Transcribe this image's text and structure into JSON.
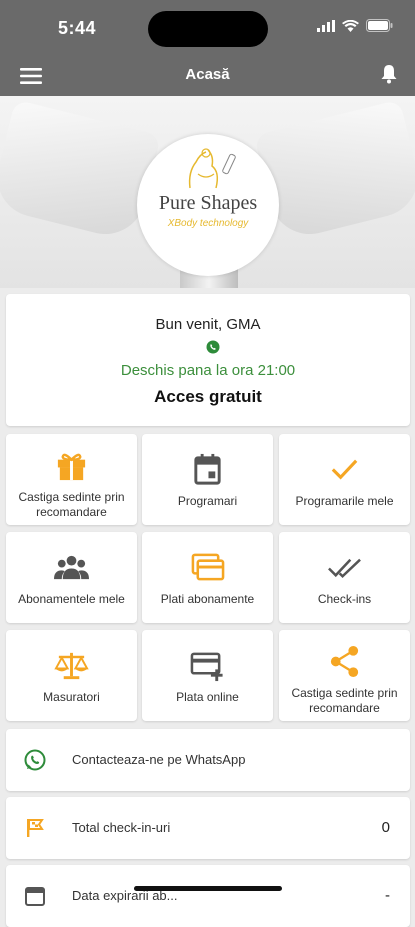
{
  "status_bar": {
    "time": "5:44"
  },
  "appbar": {
    "title": "Acasă"
  },
  "hero": {
    "brand_name": "Pure Shapes",
    "brand_tagline": "XBody technology"
  },
  "welcome": {
    "greeting": "Bun venit, GMA",
    "open_status": "Deschis pana la ora 21:00",
    "access": "Acces gratuit"
  },
  "tiles": [
    {
      "label": "Castiga sedinte prin recomandare",
      "icon": "gift-icon"
    },
    {
      "label": "Programari",
      "icon": "calendar-icon"
    },
    {
      "label": "Programarile mele",
      "icon": "checkmark-icon"
    },
    {
      "label": "Abonamentele mele",
      "icon": "group-icon"
    },
    {
      "label": "Plati abonamente",
      "icon": "cards-icon"
    },
    {
      "label": "Check-ins",
      "icon": "double-check-icon"
    },
    {
      "label": "Masuratori",
      "icon": "scale-icon"
    },
    {
      "label": "Plata online",
      "icon": "card-add-icon"
    },
    {
      "label": "Castiga sedinte prin recomandare",
      "icon": "share-icon"
    }
  ],
  "rows": [
    {
      "label": "Contacteaza-ne pe WhatsApp",
      "icon": "whatsapp-icon",
      "value": ""
    },
    {
      "label": "Total check-in-uri",
      "icon": "flag-icon",
      "value": "0"
    },
    {
      "label": "Data expirarii ab...",
      "icon": "calendar-icon",
      "value": "-"
    }
  ],
  "colors": {
    "accent": "#f5a623",
    "dark_icon": "#555555",
    "open_green": "#3c8f3c",
    "whatsapp_green": "#2e8b3a",
    "header_gray": "#6a6a6a"
  }
}
